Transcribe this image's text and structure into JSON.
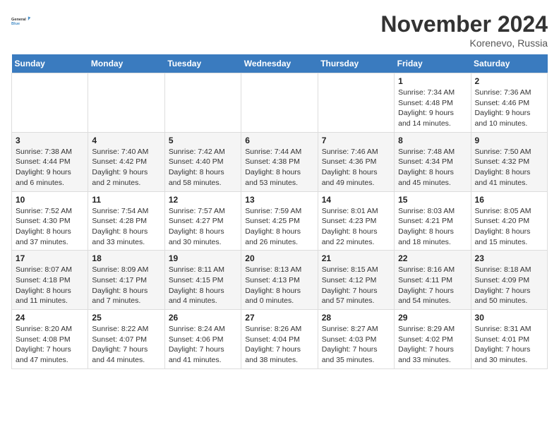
{
  "logo": {
    "line1": "General",
    "line2": "Blue"
  },
  "title": "November 2024",
  "location": "Korenevo, Russia",
  "weekdays": [
    "Sunday",
    "Monday",
    "Tuesday",
    "Wednesday",
    "Thursday",
    "Friday",
    "Saturday"
  ],
  "weeks": [
    [
      {
        "day": "",
        "info": ""
      },
      {
        "day": "",
        "info": ""
      },
      {
        "day": "",
        "info": ""
      },
      {
        "day": "",
        "info": ""
      },
      {
        "day": "",
        "info": ""
      },
      {
        "day": "1",
        "info": "Sunrise: 7:34 AM\nSunset: 4:48 PM\nDaylight: 9 hours and 14 minutes."
      },
      {
        "day": "2",
        "info": "Sunrise: 7:36 AM\nSunset: 4:46 PM\nDaylight: 9 hours and 10 minutes."
      }
    ],
    [
      {
        "day": "3",
        "info": "Sunrise: 7:38 AM\nSunset: 4:44 PM\nDaylight: 9 hours and 6 minutes."
      },
      {
        "day": "4",
        "info": "Sunrise: 7:40 AM\nSunset: 4:42 PM\nDaylight: 9 hours and 2 minutes."
      },
      {
        "day": "5",
        "info": "Sunrise: 7:42 AM\nSunset: 4:40 PM\nDaylight: 8 hours and 58 minutes."
      },
      {
        "day": "6",
        "info": "Sunrise: 7:44 AM\nSunset: 4:38 PM\nDaylight: 8 hours and 53 minutes."
      },
      {
        "day": "7",
        "info": "Sunrise: 7:46 AM\nSunset: 4:36 PM\nDaylight: 8 hours and 49 minutes."
      },
      {
        "day": "8",
        "info": "Sunrise: 7:48 AM\nSunset: 4:34 PM\nDaylight: 8 hours and 45 minutes."
      },
      {
        "day": "9",
        "info": "Sunrise: 7:50 AM\nSunset: 4:32 PM\nDaylight: 8 hours and 41 minutes."
      }
    ],
    [
      {
        "day": "10",
        "info": "Sunrise: 7:52 AM\nSunset: 4:30 PM\nDaylight: 8 hours and 37 minutes."
      },
      {
        "day": "11",
        "info": "Sunrise: 7:54 AM\nSunset: 4:28 PM\nDaylight: 8 hours and 33 minutes."
      },
      {
        "day": "12",
        "info": "Sunrise: 7:57 AM\nSunset: 4:27 PM\nDaylight: 8 hours and 30 minutes."
      },
      {
        "day": "13",
        "info": "Sunrise: 7:59 AM\nSunset: 4:25 PM\nDaylight: 8 hours and 26 minutes."
      },
      {
        "day": "14",
        "info": "Sunrise: 8:01 AM\nSunset: 4:23 PM\nDaylight: 8 hours and 22 minutes."
      },
      {
        "day": "15",
        "info": "Sunrise: 8:03 AM\nSunset: 4:21 PM\nDaylight: 8 hours and 18 minutes."
      },
      {
        "day": "16",
        "info": "Sunrise: 8:05 AM\nSunset: 4:20 PM\nDaylight: 8 hours and 15 minutes."
      }
    ],
    [
      {
        "day": "17",
        "info": "Sunrise: 8:07 AM\nSunset: 4:18 PM\nDaylight: 8 hours and 11 minutes."
      },
      {
        "day": "18",
        "info": "Sunrise: 8:09 AM\nSunset: 4:17 PM\nDaylight: 8 hours and 7 minutes."
      },
      {
        "day": "19",
        "info": "Sunrise: 8:11 AM\nSunset: 4:15 PM\nDaylight: 8 hours and 4 minutes."
      },
      {
        "day": "20",
        "info": "Sunrise: 8:13 AM\nSunset: 4:13 PM\nDaylight: 8 hours and 0 minutes."
      },
      {
        "day": "21",
        "info": "Sunrise: 8:15 AM\nSunset: 4:12 PM\nDaylight: 7 hours and 57 minutes."
      },
      {
        "day": "22",
        "info": "Sunrise: 8:16 AM\nSunset: 4:11 PM\nDaylight: 7 hours and 54 minutes."
      },
      {
        "day": "23",
        "info": "Sunrise: 8:18 AM\nSunset: 4:09 PM\nDaylight: 7 hours and 50 minutes."
      }
    ],
    [
      {
        "day": "24",
        "info": "Sunrise: 8:20 AM\nSunset: 4:08 PM\nDaylight: 7 hours and 47 minutes."
      },
      {
        "day": "25",
        "info": "Sunrise: 8:22 AM\nSunset: 4:07 PM\nDaylight: 7 hours and 44 minutes."
      },
      {
        "day": "26",
        "info": "Sunrise: 8:24 AM\nSunset: 4:06 PM\nDaylight: 7 hours and 41 minutes."
      },
      {
        "day": "27",
        "info": "Sunrise: 8:26 AM\nSunset: 4:04 PM\nDaylight: 7 hours and 38 minutes."
      },
      {
        "day": "28",
        "info": "Sunrise: 8:27 AM\nSunset: 4:03 PM\nDaylight: 7 hours and 35 minutes."
      },
      {
        "day": "29",
        "info": "Sunrise: 8:29 AM\nSunset: 4:02 PM\nDaylight: 7 hours and 33 minutes."
      },
      {
        "day": "30",
        "info": "Sunrise: 8:31 AM\nSunset: 4:01 PM\nDaylight: 7 hours and 30 minutes."
      }
    ]
  ]
}
